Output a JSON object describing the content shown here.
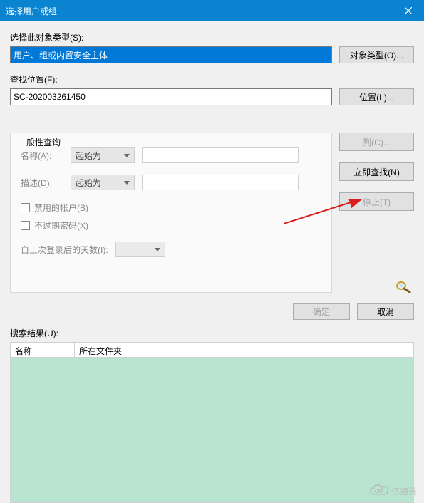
{
  "window": {
    "title": "选择用户或组"
  },
  "object_type": {
    "label": "选择此对象类型(S):",
    "value": "用户、组或内置安全主体",
    "button": "对象类型(O)..."
  },
  "location": {
    "label": "查找位置(F):",
    "value": "SC-202003261450",
    "button": "位置(L)..."
  },
  "tab": {
    "label": "一般性查询"
  },
  "query": {
    "name_label": "名称(A):",
    "desc_label": "描述(D):",
    "combo_option": "起始为",
    "chk_disabled": "禁用的帐户(B)",
    "chk_noexpire": "不过期密码(X)",
    "days_label": "自上次登录后的天数(I):"
  },
  "side_buttons": {
    "columns": "列(C)...",
    "find_now": "立即查找(N)",
    "stop": "停止(T)"
  },
  "bottom": {
    "ok": "确定",
    "cancel": "取消"
  },
  "results": {
    "label": "搜索结果(U):",
    "col_name": "名称",
    "col_location": "所在文件夹"
  },
  "watermark": "亿速云"
}
